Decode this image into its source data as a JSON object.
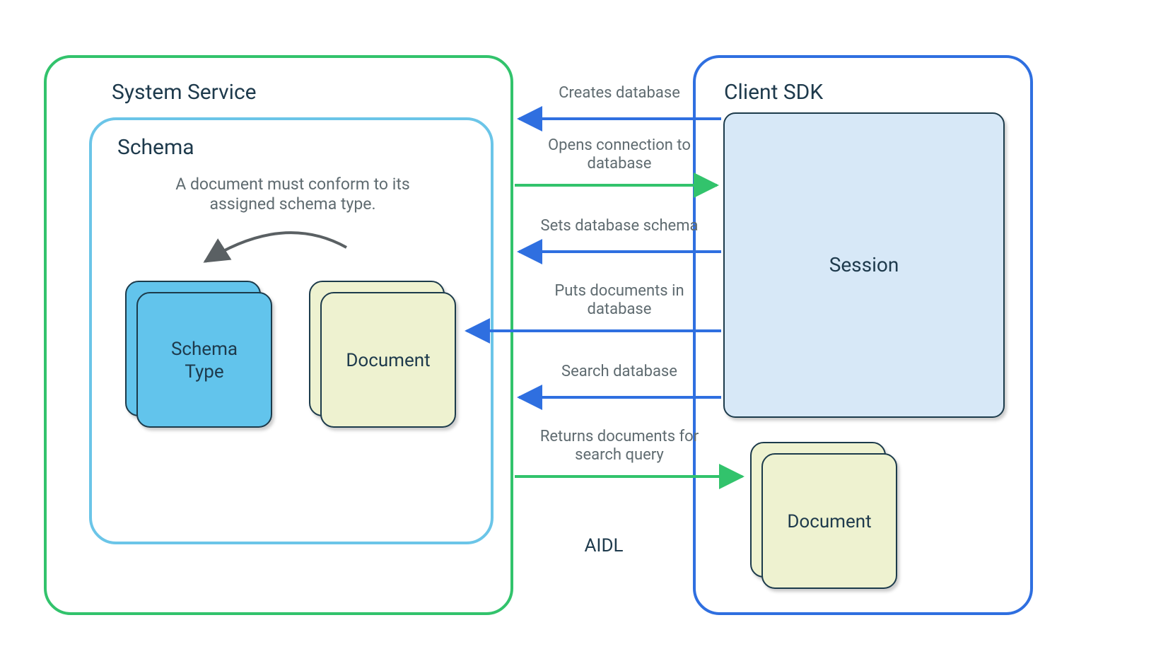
{
  "colors": {
    "green": "#32c36c",
    "blue": "#2f6fe0",
    "lightBlue": "#6bc5e8",
    "skyFill": "#62c4ec",
    "paleBlueFill": "#d7e8f7",
    "paleGreenFill": "#eef2d0",
    "textDark": "#1e3a4c",
    "textGrey": "#5f6b70",
    "arrowGrey": "#5a6063"
  },
  "systemService": {
    "title": "System Service",
    "schema": {
      "title": "Schema",
      "annotation_line1": "A document must conform to its",
      "annotation_line2": "assigned schema type.",
      "schemaType_line1": "Schema",
      "schemaType_line2": "Type",
      "document_label": "Document"
    }
  },
  "clientSdk": {
    "title": "Client SDK",
    "session_label": "Session",
    "document_label": "Document"
  },
  "middle": {
    "aidl_label": "AIDL"
  },
  "arrows": {
    "a1": "Creates database",
    "a2_line1": "Opens connection to",
    "a2_line2": "database",
    "a3": "Sets database schema",
    "a4_line1": "Puts documents in",
    "a4_line2": "database",
    "a5": "Search database",
    "a6_line1": "Returns documents for",
    "a6_line2": "search query"
  }
}
